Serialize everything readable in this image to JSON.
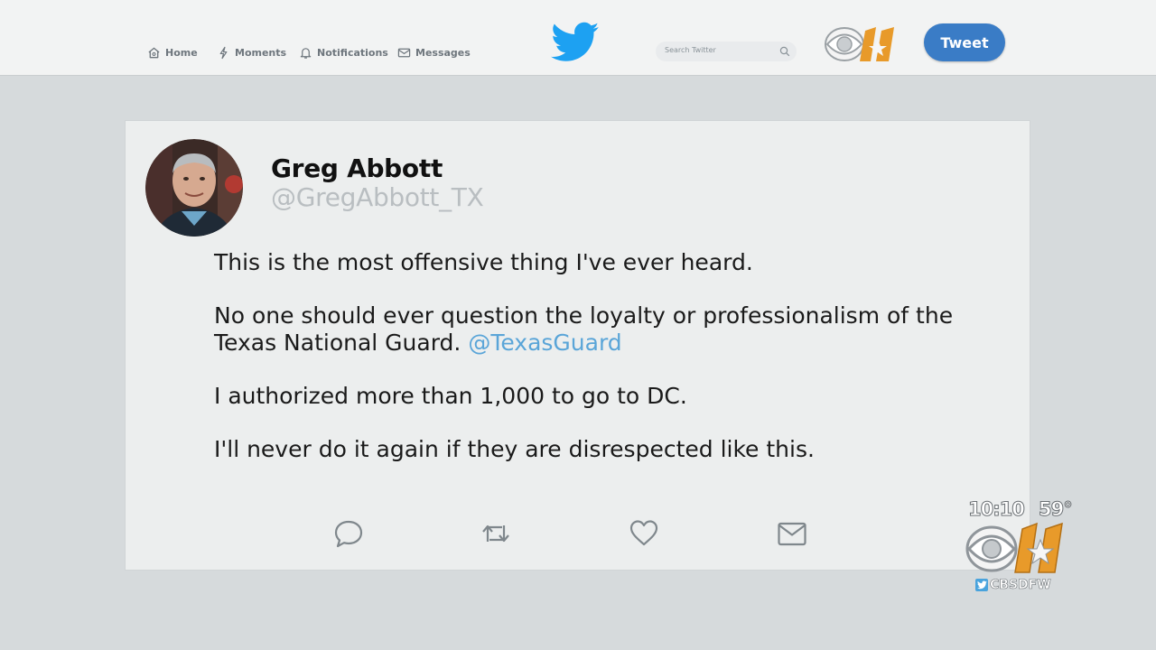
{
  "nav": {
    "home": "Home",
    "moments": "Moments",
    "notifications": "Notifications",
    "messages": "Messages"
  },
  "search": {
    "placeholder": "Search Twitter"
  },
  "header": {
    "tweet_button": "Tweet"
  },
  "tweet": {
    "author_name": "Greg Abbott",
    "author_handle": "@GregAbbott_TX",
    "paragraphs": {
      "p1": "This is the most offensive thing I've ever heard.",
      "p2": "No one should ever question the loyalty or professionalism of the Texas National Guard.",
      "p2_mention": "@TexasGuard",
      "p3": "I authorized more than 1,000 to go to DC.",
      "p4": "I'll never do it again if they are disrespected like this."
    }
  },
  "broadcast": {
    "time": "10:10",
    "temperature": "59°",
    "handle": "CBSDFW"
  },
  "colors": {
    "twitter_blue": "#1da1f2",
    "tweet_button": "#3a7cc6",
    "mention": "#5aa5d8",
    "station_orange": "#e89a2a"
  },
  "icons": {
    "nav": [
      "home-icon",
      "moments-icon",
      "notifications-icon",
      "messages-icon"
    ],
    "actions": [
      "reply-icon",
      "retweet-icon",
      "like-icon",
      "direct-message-icon"
    ]
  }
}
